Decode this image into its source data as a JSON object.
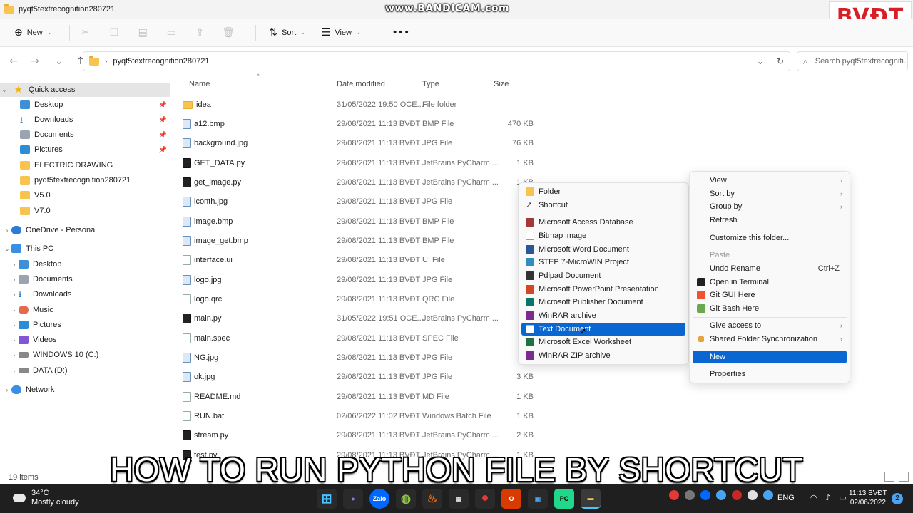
{
  "window": {
    "title": "pyqt5textrecognition280721"
  },
  "watermark": "www.BANDICAM.com",
  "brand_logo": "BVĐT",
  "toolbar": {
    "new_label": "New",
    "sort_label": "Sort",
    "view_label": "View",
    "more_label": "•••"
  },
  "address": {
    "path": "pyqt5textrecognition280721",
    "search_placeholder": "Search pyqt5textrecogniti..."
  },
  "sidebar": {
    "items": [
      {
        "label": "Quick access",
        "icon": "star"
      },
      {
        "label": "Desktop",
        "icon": "desktop"
      },
      {
        "label": "Downloads",
        "icon": "download"
      },
      {
        "label": "Documents",
        "icon": "documents"
      },
      {
        "label": "Pictures",
        "icon": "pictures"
      },
      {
        "label": "ELECTRIC DRAWING",
        "icon": "folder"
      },
      {
        "label": "pyqt5textrecognition280721",
        "icon": "folder"
      },
      {
        "label": "V5.0",
        "icon": "folder"
      },
      {
        "label": "V7.0",
        "icon": "folder"
      },
      {
        "label": "OneDrive - Personal",
        "icon": "cloud"
      },
      {
        "label": "This PC",
        "icon": "pc"
      },
      {
        "label": "Desktop",
        "icon": "desktop"
      },
      {
        "label": "Documents",
        "icon": "documents"
      },
      {
        "label": "Downloads",
        "icon": "download"
      },
      {
        "label": "Music",
        "icon": "music"
      },
      {
        "label": "Pictures",
        "icon": "pictures"
      },
      {
        "label": "Videos",
        "icon": "videos"
      },
      {
        "label": "WINDOWS 10 (C:)",
        "icon": "drive"
      },
      {
        "label": "DATA (D:)",
        "icon": "drive"
      },
      {
        "label": "Network",
        "icon": "network"
      }
    ]
  },
  "columns": {
    "name": "Name",
    "date": "Date modified",
    "type": "Type",
    "size": "Size"
  },
  "files": [
    {
      "name": ".idea",
      "date": "31/05/2022 19:50  OCE...",
      "type": "File folder",
      "size": ""
    },
    {
      "name": "a12.bmp",
      "date": "29/08/2021 11:13  BVĐT",
      "type": "BMP File",
      "size": "470 KB"
    },
    {
      "name": "background.jpg",
      "date": "29/08/2021 11:13  BVĐT",
      "type": "JPG File",
      "size": "76 KB"
    },
    {
      "name": "GET_DATA.py",
      "date": "29/08/2021 11:13  BVĐT",
      "type": "JetBrains PyCharm ...",
      "size": "1 KB"
    },
    {
      "name": "get_image.py",
      "date": "29/08/2021 11:13  BVĐT",
      "type": "JetBrains PyCharm ...",
      "size": "1 KB"
    },
    {
      "name": "iconth.jpg",
      "date": "29/08/2021 11:13  BVĐT",
      "type": "JPG File",
      "size": "1"
    },
    {
      "name": "image.bmp",
      "date": "29/08/2021 11:13  BVĐT",
      "type": "BMP File",
      "size": ""
    },
    {
      "name": "image_get.bmp",
      "date": "29/08/2021 11:13  BVĐT",
      "type": "BMP File",
      "size": "46"
    },
    {
      "name": "interface.ui",
      "date": "29/08/2021 11:13  BVĐT",
      "type": "UI File",
      "size": "2"
    },
    {
      "name": "logo.jpg",
      "date": "29/08/2021 11:13  BVĐT",
      "type": "JPG File",
      "size": "1"
    },
    {
      "name": "logo.qrc",
      "date": "29/08/2021 11:13  BVĐT",
      "type": "QRC File",
      "size": ""
    },
    {
      "name": "main.py",
      "date": "31/05/2022 19:51  OCE...",
      "type": "JetBrains PyCharm ...",
      "size": ""
    },
    {
      "name": "main.spec",
      "date": "29/08/2021 11:13  BVĐT",
      "type": "SPEC File",
      "size": ""
    },
    {
      "name": "NG.jpg",
      "date": "29/08/2021 11:13  BVĐT",
      "type": "JPG File",
      "size": ""
    },
    {
      "name": "ok.jpg",
      "date": "29/08/2021 11:13  BVĐT",
      "type": "JPG File",
      "size": "3 KB"
    },
    {
      "name": "README.md",
      "date": "29/08/2021 11:13  BVĐT",
      "type": "MD File",
      "size": "1 KB"
    },
    {
      "name": "RUN.bat",
      "date": "02/06/2022 11:02  BVĐT",
      "type": "Windows Batch File",
      "size": "1 KB"
    },
    {
      "name": "stream.py",
      "date": "29/08/2021 11:13  BVĐT",
      "type": "JetBrains PyCharm ...",
      "size": "2 KB"
    },
    {
      "name": "test.py",
      "date": "29/08/2021 11:13  BVĐT",
      "type": "JetBrains PyCharm ...",
      "size": "1 KB"
    }
  ],
  "status": {
    "item_count": "19 items"
  },
  "context_menu": {
    "view": "View",
    "sort_by": "Sort by",
    "group_by": "Group by",
    "refresh": "Refresh",
    "customize": "Customize this folder...",
    "paste": "Paste",
    "undo_rename": "Undo Rename",
    "undo_shortcut": "Ctrl+Z",
    "open_terminal": "Open in Terminal",
    "git_gui": "Git GUI Here",
    "git_bash": "Git Bash Here",
    "give_access": "Give access to",
    "shared_sync": "Shared Folder Synchronization",
    "new": "New",
    "properties": "Properties"
  },
  "new_submenu": {
    "folder": "Folder",
    "shortcut": "Shortcut",
    "items": [
      "Microsoft Access Database",
      "Bitmap image",
      "Microsoft Word Document",
      "STEP 7-MicroWIN Project",
      "Pdlpad Document",
      "Microsoft PowerPoint Presentation",
      "Microsoft Publisher Document",
      "WinRAR archive",
      "Text Document",
      "Microsoft Excel Worksheet",
      "WinRAR ZIP archive"
    ]
  },
  "caption": "HOW TO RUN PYTHON FILE BY SHORTCUT",
  "taskbar": {
    "temperature": "34°C",
    "condition": "Mostly cloudy",
    "language": "ENG",
    "time": "11:13",
    "user": "BVĐT",
    "date": "02/06/2022",
    "notifications": "2"
  }
}
